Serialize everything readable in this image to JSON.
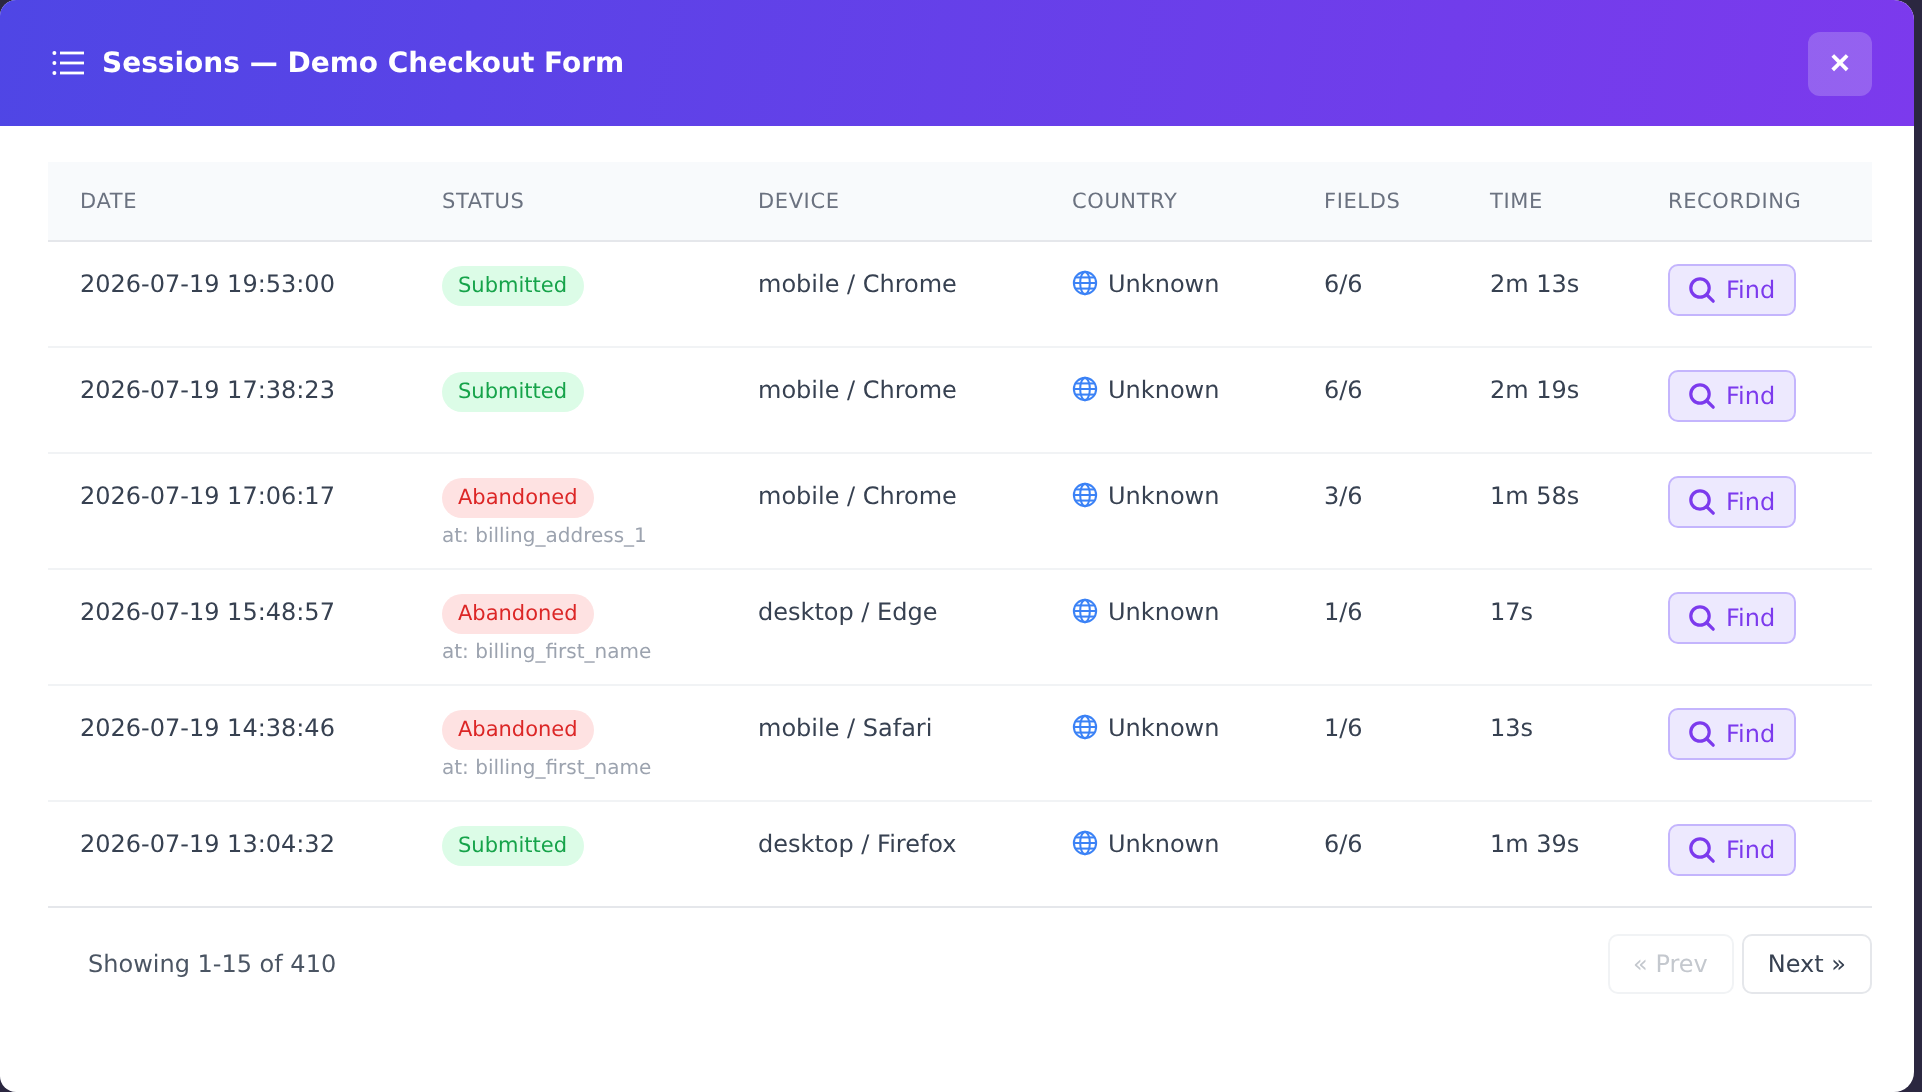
{
  "window": {
    "title": "Sessions — Demo Checkout Form",
    "close": "×"
  },
  "table": {
    "columns": [
      "DATE",
      "STATUS",
      "DEVICE",
      "COUNTRY",
      "FIELDS",
      "TIME",
      "RECORDING"
    ],
    "rows": [
      {
        "date": "2026-07-19 19:53:00",
        "status": {
          "kind": "submitted",
          "label": "Submitted"
        },
        "device": "mobile / Chrome",
        "country": "Unknown",
        "fields": "6/6",
        "time": "2m 13s",
        "action": "Find"
      },
      {
        "date": "2026-07-19 17:38:23",
        "status": {
          "kind": "submitted",
          "label": "Submitted"
        },
        "device": "mobile / Chrome",
        "country": "Unknown",
        "fields": "6/6",
        "time": "2m 19s",
        "action": "Find"
      },
      {
        "date": "2026-07-19 17:06:17",
        "status": {
          "kind": "abandoned",
          "label": "Abandoned",
          "note": "at: billing_address_1"
        },
        "device": "mobile / Chrome",
        "country": "Unknown",
        "fields": "3/6",
        "time": "1m 58s",
        "action": "Find"
      },
      {
        "date": "2026-07-19 15:48:57",
        "status": {
          "kind": "abandoned",
          "label": "Abandoned",
          "note": "at: billing_first_name"
        },
        "device": "desktop / Edge",
        "country": "Unknown",
        "fields": "1/6",
        "time": "17s",
        "action": "Find"
      },
      {
        "date": "2026-07-19 14:38:46",
        "status": {
          "kind": "abandoned",
          "label": "Abandoned",
          "note": "at: billing_first_name"
        },
        "device": "mobile / Safari",
        "country": "Unknown",
        "fields": "1/6",
        "time": "13s",
        "action": "Find"
      },
      {
        "date": "2026-07-19 13:04:32",
        "status": {
          "kind": "submitted",
          "label": "Submitted"
        },
        "device": "desktop / Firefox",
        "country": "Unknown",
        "fields": "6/6",
        "time": "1m 39s",
        "action": "Find"
      }
    ]
  },
  "footer": {
    "summary": "Showing 1-15 of 410",
    "prev": {
      "label": "« Prev",
      "disabled": true
    },
    "next": {
      "label": "Next »",
      "disabled": false
    }
  }
}
